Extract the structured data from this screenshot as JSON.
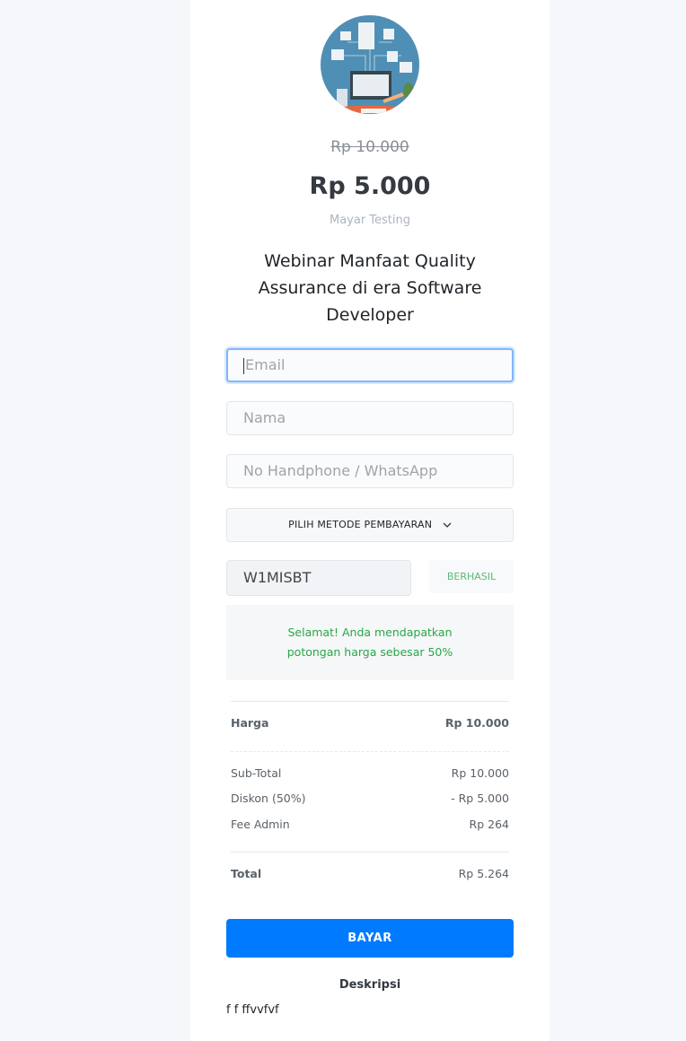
{
  "product": {
    "original_price": "Rp 10.000",
    "price": "Rp 5.000",
    "merchant": "Mayar Testing",
    "title": "Webinar Manfaat Quality Assurance di era Software Developer"
  },
  "form": {
    "email_placeholder": "Email",
    "name_placeholder": "Nama",
    "phone_placeholder": "No Handphone / WhatsApp",
    "payment_method_label": "PILIH METODE PEMBAYARAN",
    "coupon_value": "W1MISBT",
    "coupon_status": "BERHASIL"
  },
  "alert": {
    "message": "Selamat! Anda mendapatkan potongan harga sebesar 50%"
  },
  "summary": {
    "harga": {
      "label": "Harga",
      "value": "Rp 10.000"
    },
    "subtotal": {
      "label": "Sub-Total",
      "value": "Rp 10.000"
    },
    "diskon": {
      "label": "Diskon (50%)",
      "value": "- Rp 5.000"
    },
    "fee": {
      "label": "Fee Admin",
      "value": "Rp 264"
    },
    "total": {
      "label": "Total",
      "value": "Rp 5.264"
    }
  },
  "pay_label": "BAYAR",
  "description": {
    "heading": "Deskripsi",
    "text": "f f ffvvfvf"
  },
  "colors": {
    "accent": "#007bff",
    "success": "#28a745",
    "background": "#f5f7fa"
  }
}
